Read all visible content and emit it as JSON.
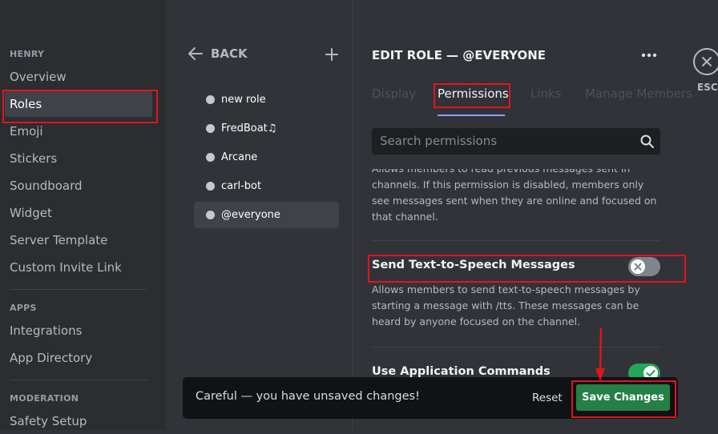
{
  "sidebar": {
    "server_header": "HENRY",
    "items": [
      "Overview",
      "Roles",
      "Emoji",
      "Stickers",
      "Soundboard",
      "Widget",
      "Server Template",
      "Custom Invite Link"
    ],
    "apps_header": "APPS",
    "apps_items": [
      "Integrations",
      "App Directory"
    ],
    "moderation_header": "MODERATION",
    "moderation_items": [
      "Safety Setup"
    ]
  },
  "roles": {
    "back_label": "BACK",
    "list": [
      "new role",
      "FredBoat♫",
      "Arcane",
      "carl-bot",
      "@everyone"
    ]
  },
  "editor": {
    "title": "EDIT ROLE — @EVERYONE",
    "tabs": [
      "Display",
      "Permissions",
      "Links",
      "Manage Members"
    ],
    "search_placeholder": "Search permissions",
    "prev_desc": "Allows members to read previous messages sent in channels. If this permission is disabled, members only see messages sent when they are online and focused on that channel.",
    "perms": [
      {
        "title": "Send Text-to-Speech Messages",
        "desc": "Allows members to send text-to-speech messages by starting a message with /tts. These messages can be heard by anyone focused on the channel.",
        "enabled": false
      },
      {
        "title": "Use Application Commands",
        "enabled": true
      }
    ]
  },
  "close": {
    "label": "ESC"
  },
  "notice": {
    "text": "Careful — you have unsaved changes!",
    "reset_label": "Reset",
    "save_label": "Save Changes"
  },
  "colors": {
    "accent_green": "#248046",
    "toggle_on": "#23a55a",
    "highlight_red": "#e0141f"
  }
}
